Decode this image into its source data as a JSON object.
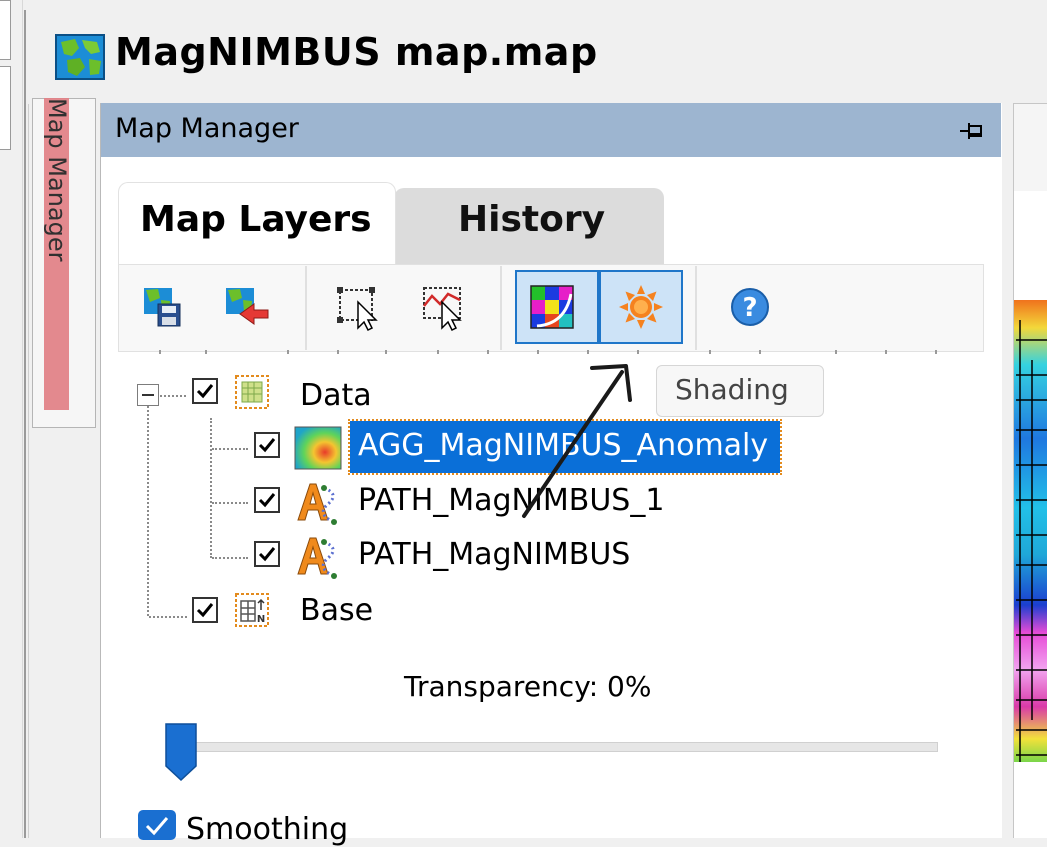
{
  "window": {
    "title": "MagNIMBUS map.map"
  },
  "side_tab": {
    "label": "Map Manager"
  },
  "panel": {
    "title": "Map Manager",
    "tabs": [
      {
        "label": "Map Layers",
        "active": true
      },
      {
        "label": "History",
        "active": false
      }
    ]
  },
  "toolbar": {
    "buttons": [
      {
        "icon": "save-map-icon",
        "pressed": false
      },
      {
        "icon": "import-map-icon",
        "pressed": false
      },
      {
        "icon": "select-frame-icon",
        "pressed": false
      },
      {
        "icon": "profile-select-icon",
        "pressed": false
      },
      {
        "icon": "color-table-icon",
        "pressed": true
      },
      {
        "icon": "shading-sun-icon",
        "pressed": true
      },
      {
        "icon": "help-icon",
        "pressed": false
      }
    ]
  },
  "tooltip": {
    "text": "Shading"
  },
  "layers": {
    "data_group": {
      "label": "Data",
      "checked": true,
      "expanded": true
    },
    "items": [
      {
        "label": "AGG_MagNIMBUS_Anomaly",
        "checked": true,
        "selected": true,
        "icon": "grid-image-icon"
      },
      {
        "label": "PATH_MagNIMBUS_1",
        "checked": true,
        "selected": false,
        "icon": "path-layer-icon"
      },
      {
        "label": "PATH_MagNIMBUS",
        "checked": true,
        "selected": false,
        "icon": "path-layer-icon"
      }
    ],
    "base_group": {
      "label": "Base",
      "checked": true
    }
  },
  "transparency": {
    "label": "Transparency: 0%",
    "value_percent": 0
  },
  "smoothing": {
    "label": "Smoothing",
    "checked": true
  },
  "colors": {
    "panel_header": "#9db5d0",
    "selection": "#0a6fd8",
    "accent": "#1f76c9"
  }
}
